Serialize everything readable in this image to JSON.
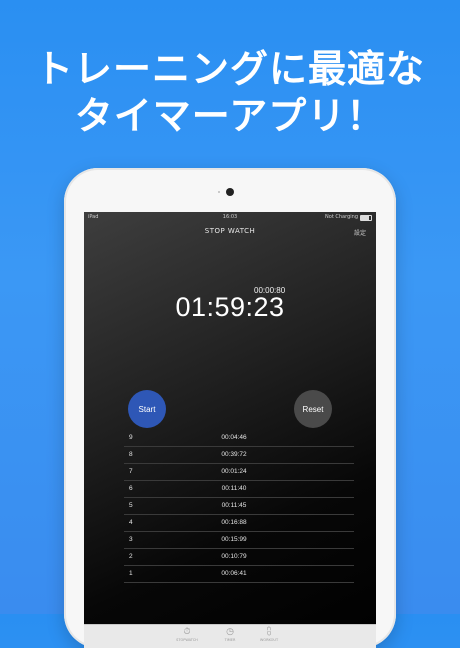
{
  "headline": {
    "line1": "トレーニングに最適な",
    "line2": "タイマーアプリ！"
  },
  "device": {
    "statusbar": {
      "carrier": "iPad",
      "time": "16:03",
      "battery_text": "Not Charging"
    },
    "nav": {
      "title": "STOP WATCH",
      "settings": "設定"
    },
    "timer": {
      "lap_time": "00:00:80",
      "main_time": "01:59:23"
    },
    "buttons": {
      "start": "Start",
      "reset": "Reset"
    },
    "laps": [
      {
        "num": "9",
        "time": "00:04:46"
      },
      {
        "num": "8",
        "time": "00:39:72"
      },
      {
        "num": "7",
        "time": "00:01:24"
      },
      {
        "num": "6",
        "time": "00:11:40"
      },
      {
        "num": "5",
        "time": "00:11:45"
      },
      {
        "num": "4",
        "time": "00:16:88"
      },
      {
        "num": "3",
        "time": "00:15:99"
      },
      {
        "num": "2",
        "time": "00:10:79"
      },
      {
        "num": "1",
        "time": "00:06:41"
      }
    ],
    "tabs": [
      {
        "icon": "stopwatch-icon",
        "glyph": "⏱",
        "label": "STOPWATCH"
      },
      {
        "icon": "clock-icon",
        "glyph": "◷",
        "label": "TIMER"
      },
      {
        "icon": "dumbbell-icon",
        "glyph": "⩉",
        "label": "WORKOUT"
      }
    ]
  }
}
